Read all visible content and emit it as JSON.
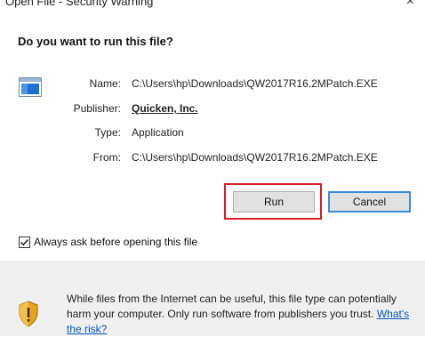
{
  "window": {
    "title": "Open File - Security Warning",
    "close_glyph": "×"
  },
  "dialog": {
    "question": "Do you want to run this file?",
    "icon": "application-file-icon",
    "fields": {
      "name_label": "Name:",
      "name_value": "C:\\Users\\hp\\Downloads\\QW2017R16.2MPatch.EXE",
      "publisher_label": "Publisher:",
      "publisher_value": "Quicken, Inc.",
      "type_label": "Type:",
      "type_value": "Application",
      "from_label": "From:",
      "from_value": "C:\\Users\\hp\\Downloads\\QW2017R16.2MPatch.EXE"
    },
    "buttons": {
      "run": "Run",
      "cancel": "Cancel"
    },
    "checkbox": {
      "label": "Always ask before opening this file",
      "checked": true
    }
  },
  "footer": {
    "icon": "shield-warning-icon",
    "warning_text": "While files from the Internet can be useful, this file type can potentially harm your computer. Only run software from publishers you trust. ",
    "risk_link": "What's the risk?"
  },
  "colors": {
    "link": "#0a55c8",
    "highlight_border": "#d81e2a",
    "cancel_focus_border": "#3c8ad8",
    "footer_bg": "#f0f0f0"
  }
}
